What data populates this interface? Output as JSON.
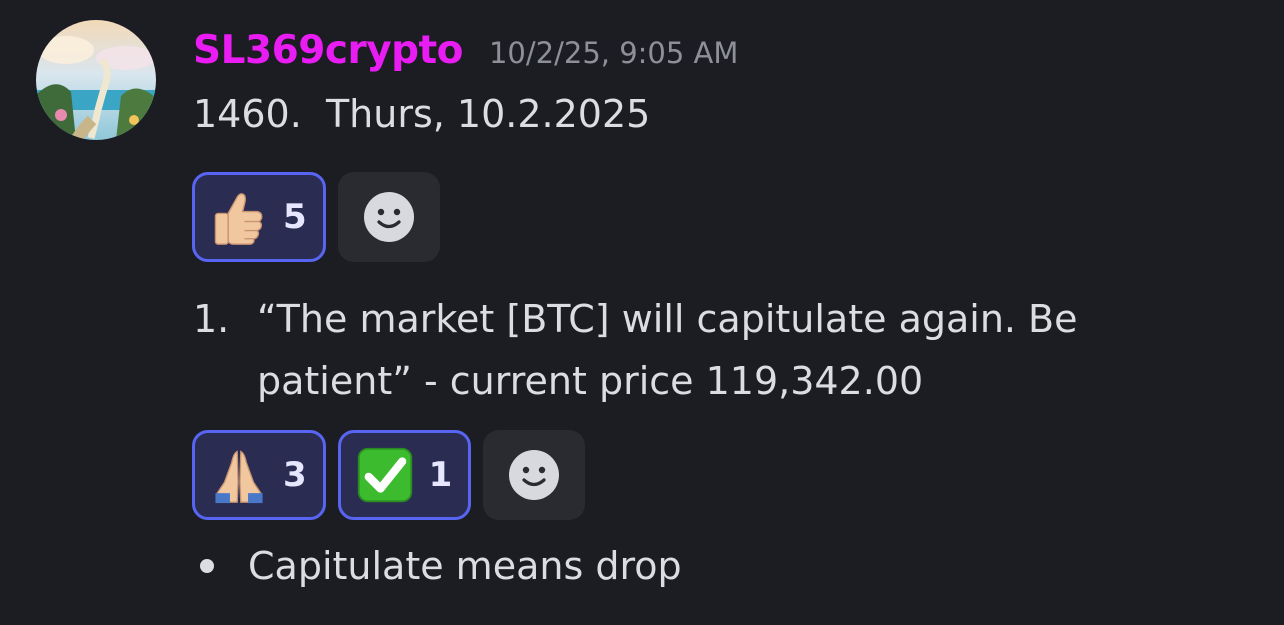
{
  "message": {
    "username": "SL369crypto",
    "username_color": "#e81cf3",
    "timestamp": "10/2/25, 9:05 AM",
    "title_line": "1460.  Thurs, 10.2.2025",
    "reactions_top": [
      {
        "emoji": "thumbs-up-light-skin-icon",
        "count": "5"
      }
    ],
    "list_item": {
      "number": "1.",
      "text": "“The market [BTC] will capitulate again. Be patient” - current price 119,342.00"
    },
    "reactions_bottom": [
      {
        "emoji": "folded-hands-light-skin-icon",
        "count": "3"
      },
      {
        "emoji": "check-mark-button-icon",
        "count": "1"
      }
    ],
    "bullet_item": {
      "text": "Capitulate means drop"
    }
  },
  "colors": {
    "background": "#1c1d22",
    "reaction_bg": "#2b2c52",
    "reaction_border": "#5865f2",
    "add_reaction_bg": "#2a2b31",
    "timestamp": "#8e9097"
  }
}
